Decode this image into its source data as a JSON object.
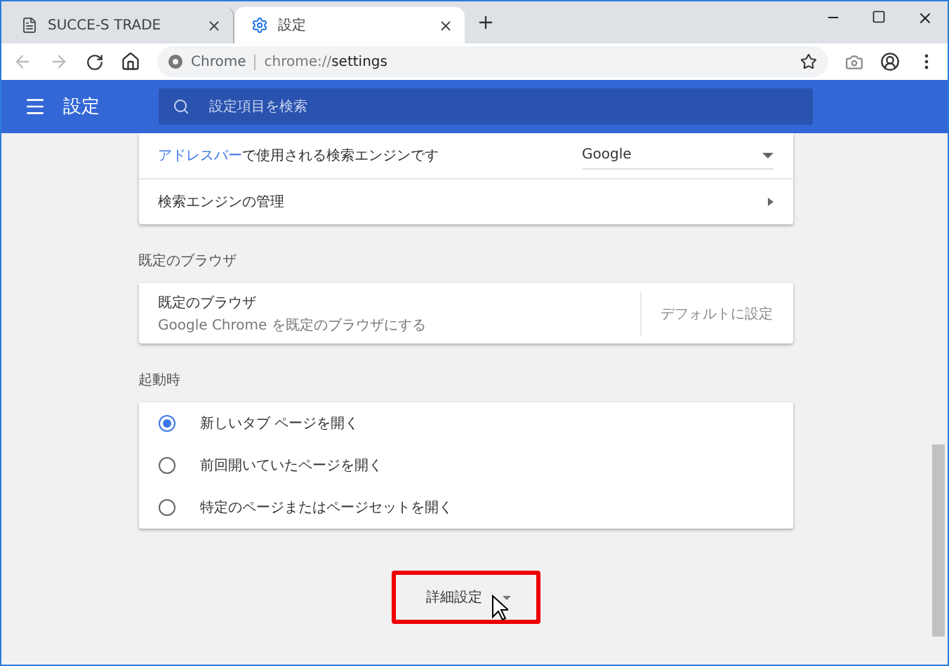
{
  "tabs": [
    {
      "title": "SUCCE-S TRADE",
      "kind": "page",
      "selected": false
    },
    {
      "title": "設定",
      "kind": "settings",
      "selected": true
    }
  ],
  "address_bar": {
    "site_label": "Chrome",
    "url_scheme": "chrome://",
    "url_path": "settings"
  },
  "header": {
    "title": "設定",
    "search_placeholder": "設定項目を検索"
  },
  "search_engine_card": {
    "rows": [
      {
        "kind": "select",
        "link": "アドレスバー",
        "label": "で使用される検索エンジンです",
        "value": "Google"
      },
      {
        "kind": "arrow",
        "label": "検索エンジンの管理"
      }
    ]
  },
  "default_browser": {
    "heading": "既定のブラウザ",
    "title": "既定のブラウザ",
    "subtitle": "Google Chrome を既定のブラウザにする",
    "button": "デフォルトに設定"
  },
  "startup": {
    "heading": "起動時",
    "options": [
      {
        "label": "新しいタブ ページを開く",
        "selected": true
      },
      {
        "label": "前回開いていたページを開く",
        "selected": false
      },
      {
        "label": "特定のページまたはページセットを開く",
        "selected": false
      }
    ]
  },
  "advanced_button": {
    "label": "詳細設定"
  }
}
